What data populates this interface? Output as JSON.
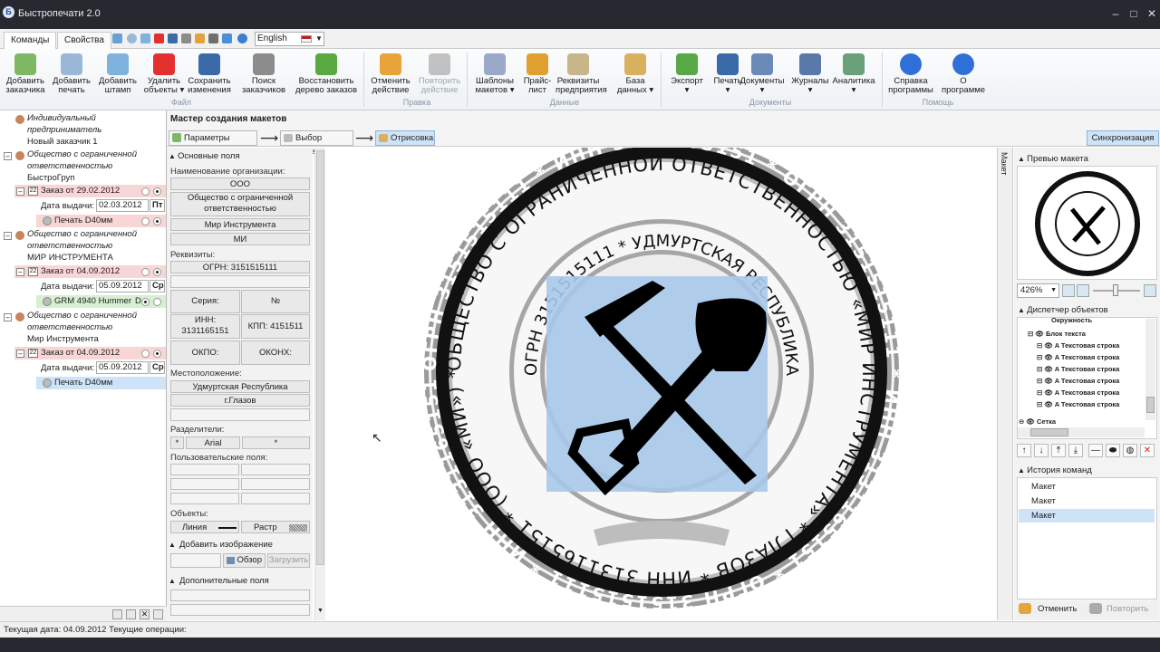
{
  "window": {
    "title": "Быстропечати 2.0"
  },
  "tabs": [
    "Команды",
    "Свойства"
  ],
  "language": "English",
  "ribbon": {
    "file": [
      {
        "l1": "Добавить",
        "l2": "заказчика"
      },
      {
        "l1": "Добавить",
        "l2": "печать"
      },
      {
        "l1": "Добавить",
        "l2": "штамп"
      },
      {
        "l1": "Удалить",
        "l2": "объекты ▾"
      },
      {
        "l1": "Сохранить",
        "l2": "изменения"
      },
      {
        "l1": "Поиск",
        "l2": "заказчиков"
      },
      {
        "l1": "Восстановить",
        "l2": "дерево заказов"
      }
    ],
    "edit": [
      {
        "l1": "Отменить",
        "l2": "действие"
      },
      {
        "l1": "Повторить",
        "l2": "действие"
      }
    ],
    "data": [
      {
        "l1": "Шаблоны",
        "l2": "макетов ▾"
      },
      {
        "l1": "Прайс-",
        "l2": "лист"
      },
      {
        "l1": "Реквизиты",
        "l2": "предприятия"
      },
      {
        "l1": "База",
        "l2": "данных ▾"
      }
    ],
    "docs": [
      {
        "l1": "Экспорт",
        "l2": "▾"
      },
      {
        "l1": "Печать",
        "l2": "▾"
      },
      {
        "l1": "Документы",
        "l2": "▾"
      },
      {
        "l1": "Журналы",
        "l2": "▾"
      },
      {
        "l1": "Аналитика",
        "l2": "▾"
      }
    ],
    "help": [
      {
        "l1": "Справка",
        "l2": "программы"
      },
      {
        "l1": "О",
        "l2": "программе"
      }
    ],
    "groups": {
      "file": "Файл",
      "edit": "Правка",
      "data": "Данные",
      "docs": "Документы",
      "help": "Помощь"
    }
  },
  "tree": {
    "c1": [
      "Индивидуальный",
      "предприниматель",
      "Новый заказчик 1"
    ],
    "c2": [
      "Общество с ограниченной",
      "ответственностью",
      "БыстроГруп"
    ],
    "o1": {
      "order": "Заказ от 29.02.2012",
      "dateLabel": "Дата выдачи:",
      "date": "02.03.2012",
      "day": "Пт",
      "item": "Печать D40мм"
    },
    "c3": [
      "Общество с ограниченной",
      "ответственностью",
      "МИР ИНСТРУМЕНТА"
    ],
    "o2": {
      "order": "Заказ от 04.09.2012",
      "dateLabel": "Дата выдачи:",
      "date": "05.09.2012",
      "day": "Ср",
      "item": "GRM 4940 Hummer",
      "itemTail": "D"
    },
    "c4": [
      "Общество с ограниченной",
      "ответственностью",
      "Мир Инструмента"
    ],
    "o3": {
      "order": "Заказ от 04.09.2012",
      "dateLabel": "Дата выдачи:",
      "date": "05.09.2012",
      "day": "Ср",
      "item": "Печать D40мм"
    }
  },
  "wizard": {
    "title": "Мастер создания макетов",
    "steps": [
      "Параметры заказа",
      "Выбор макета",
      "Отрисовка"
    ],
    "sync": "Синхронизация"
  },
  "props": {
    "main": "Основные поля",
    "orgLabel": "Наименование организации:",
    "org1": "ООО",
    "org2a": "Общество с ограниченной",
    "org2b": "ответственностью",
    "org3": "Мир Инструмента",
    "org4": "МИ",
    "reqLabel": "Реквизиты:",
    "ogrn": "ОГРН: 3151515111",
    "seria": "Серия:",
    "num": "№",
    "inn1": "ИНН:",
    "inn2": "3131165151",
    "kpp": "КПП: 4151511",
    "okpo": "ОКПО:",
    "okonh": "ОКОНХ:",
    "locLabel": "Местоположение:",
    "loc1": "Удмуртская Республика",
    "loc2": "г.Глазов",
    "sepLabel": "Разделители:",
    "sep1": "*",
    "font": "Arial",
    "sep2": "*",
    "userLabel": "Пользовательские поля:",
    "objLabel": "Объекты:",
    "line": "Линия",
    "raster": "Растр",
    "addImg": "Добавить изображение",
    "browse": "Обзор",
    "load": "Загрузить",
    "extra": "Дополнительные поля"
  },
  "stamp": {
    "outer": "ОГРН 3151515111 * ИНН 3131165151 * ОГРН 3151515111 * ИНН 3131165151 * ОГРН 3151515111 * ИНН 3131165151 * ",
    "middle": "ОБЩЕСТВО С ОГРАНИЧЕННОЙ ОТВЕТСТВЕННОСТЬЮ «МИР ИНСТРУМЕНТА» * ГЛАЗОВ * ИНН 3131165151 * (ООО «МИ») *",
    "inner": "ОГРН 3151515111 * УДМУРТСКАЯ РЕСПУБЛИКА"
  },
  "side": "Макет",
  "preview": {
    "title": "Превью макета",
    "zoom": "426%"
  },
  "dispatcher": {
    "title": "Диспетчер объектов",
    "items": [
      "Окружность",
      "Блок текста",
      "Текстовая строка",
      "Текстовая строка",
      "Текстовая строка",
      "Текстовая строка",
      "Текстовая строка",
      "Текстовая строка",
      "Сетка"
    ]
  },
  "history": {
    "title": "История команд",
    "items": [
      "Макет",
      "Макет",
      "Макет"
    ],
    "undo": "Отменить",
    "redo": "Повторить"
  },
  "status": {
    "label": "Текущая дата:",
    "date": "04.09.2012",
    "ops": "Текущие операции:"
  }
}
